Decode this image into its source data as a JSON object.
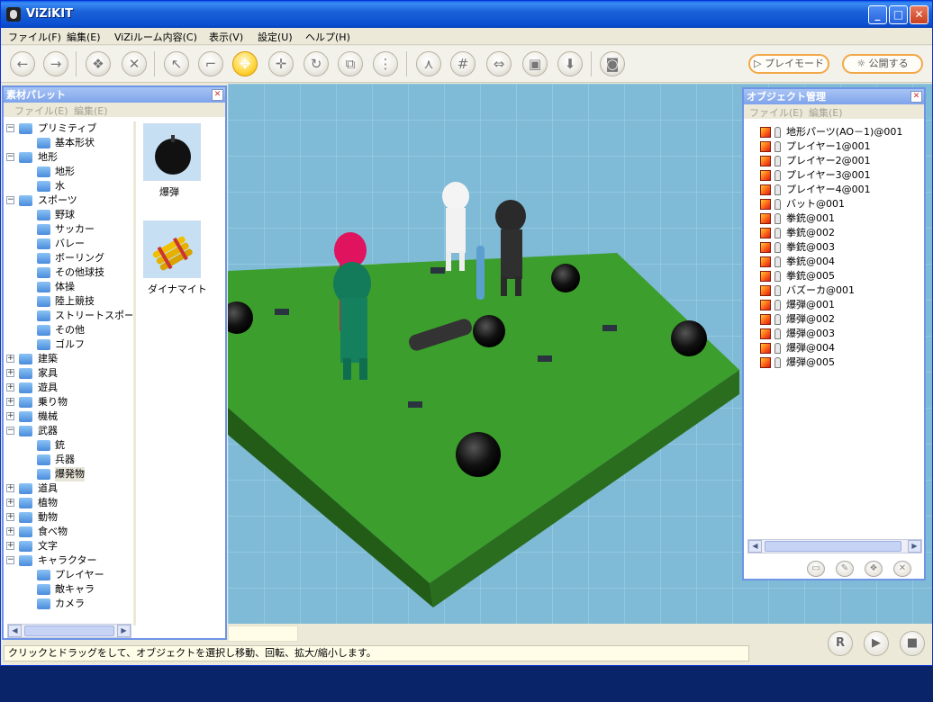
{
  "window": {
    "title": "ViZiKIT"
  },
  "menu": [
    "ファイル(F)",
    "編集(E)",
    "ViZiルーム内容(C)",
    "表示(V)",
    "設定(U)",
    "ヘルプ(H)"
  ],
  "toolbar": {
    "play_mode_label": "▷ プレイモード",
    "publish_label": "☼ 公開する",
    "buttons": [
      "back",
      "forward",
      "scene",
      "delete",
      "select",
      "local",
      "move-active",
      "move",
      "rotate",
      "scale",
      "xyz",
      "axis",
      "grid-on",
      "snap-on",
      "box-on",
      "import"
    ]
  },
  "palette": {
    "title": "素材パレット",
    "menu": [
      "ファイル(E)",
      "編集(E)"
    ],
    "tree": [
      {
        "label": "プリミティブ",
        "level": 0,
        "expanded": true
      },
      {
        "label": "基本形状",
        "level": 1
      },
      {
        "label": "地形",
        "level": 0,
        "expanded": true
      },
      {
        "label": "地形",
        "level": 1
      },
      {
        "label": "水",
        "level": 1
      },
      {
        "label": "スポーツ",
        "level": 0,
        "expanded": true
      },
      {
        "label": "野球",
        "level": 1
      },
      {
        "label": "サッカー",
        "level": 1
      },
      {
        "label": "バレー",
        "level": 1
      },
      {
        "label": "ボーリング",
        "level": 1
      },
      {
        "label": "その他球技",
        "level": 1
      },
      {
        "label": "体操",
        "level": 1
      },
      {
        "label": "陸上競技",
        "level": 1
      },
      {
        "label": "ストリートスポーツ",
        "level": 1
      },
      {
        "label": "その他",
        "level": 1
      },
      {
        "label": "ゴルフ",
        "level": 1
      },
      {
        "label": "建築",
        "level": 0,
        "expanded": false
      },
      {
        "label": "家具",
        "level": 0,
        "expanded": false
      },
      {
        "label": "遊具",
        "level": 0,
        "expanded": false
      },
      {
        "label": "乗り物",
        "level": 0,
        "expanded": false
      },
      {
        "label": "機械",
        "level": 0,
        "expanded": false
      },
      {
        "label": "武器",
        "level": 0,
        "expanded": true
      },
      {
        "label": "銃",
        "level": 1
      },
      {
        "label": "兵器",
        "level": 1
      },
      {
        "label": "爆発物",
        "level": 1,
        "selected": true
      },
      {
        "label": "道具",
        "level": 0,
        "expanded": false
      },
      {
        "label": "植物",
        "level": 0,
        "expanded": false
      },
      {
        "label": "動物",
        "level": 0,
        "expanded": false
      },
      {
        "label": "食べ物",
        "level": 0,
        "expanded": false
      },
      {
        "label": "文字",
        "level": 0,
        "expanded": false
      },
      {
        "label": "キャラクター",
        "level": 0,
        "expanded": true
      },
      {
        "label": "プレイヤー",
        "level": 1
      },
      {
        "label": "敵キャラ",
        "level": 1
      },
      {
        "label": "カメラ",
        "level": 1
      }
    ],
    "assets": [
      {
        "label": "爆弾",
        "icon": "bomb-icon"
      },
      {
        "label": "ダイナマイト",
        "icon": "dynamite-icon"
      }
    ]
  },
  "object_manager": {
    "title": "オブジェクト管理",
    "menu": [
      "ファイル(E)",
      "編集(E)"
    ],
    "objects": [
      "地形パーツ(AO－1)@001",
      "プレイヤー1@001",
      "プレイヤー2@001",
      "プレイヤー3@001",
      "プレイヤー4@001",
      "バット@001",
      "拳銃@001",
      "拳銃@002",
      "拳銃@003",
      "拳銃@004",
      "拳銃@005",
      "バズーカ@001",
      "爆弾@001",
      "爆弾@002",
      "爆弾@003",
      "爆弾@004",
      "爆弾@005"
    ]
  },
  "status": {
    "text": "クリックとドラッグをして、オブジェクトを選択し移動、回転、拡大/縮小します。",
    "playback": [
      "R",
      "▶",
      "■"
    ]
  },
  "colors": {
    "sky": "#7fbad6",
    "grass": "#3a9c2a",
    "accent": "#f2a848"
  }
}
